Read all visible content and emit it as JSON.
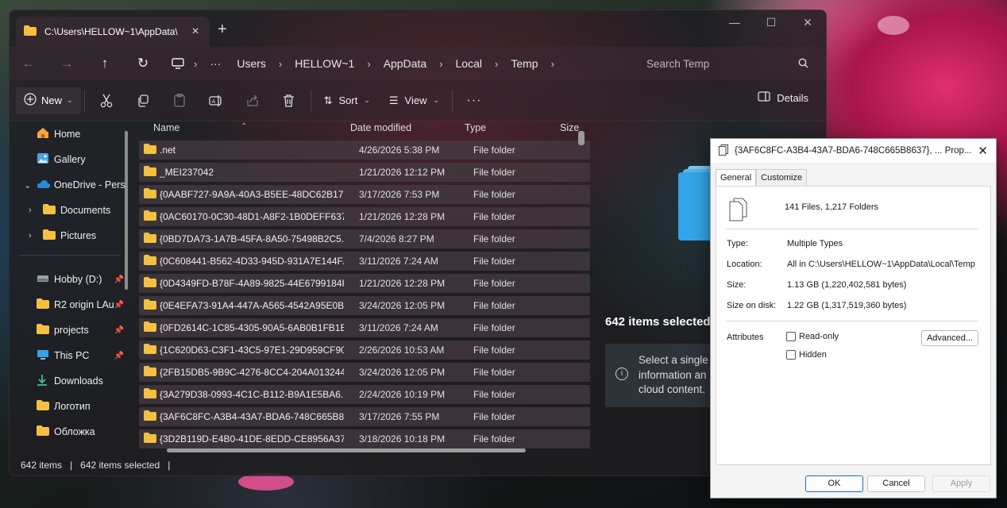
{
  "explorer": {
    "tab_title": "C:\\Users\\HELLOW~1\\AppData\\",
    "address": {
      "crumbs": [
        "Users",
        "HELLOW~1",
        "AppData",
        "Local",
        "Temp"
      ],
      "search_placeholder": "Search Temp"
    },
    "toolbar": {
      "new_label": "New",
      "sort_label": "Sort",
      "view_label": "View",
      "details_label": "Details"
    },
    "sidebar": {
      "items": [
        {
          "label": "Home",
          "icon": "home-icon"
        },
        {
          "label": "Gallery",
          "icon": "gallery-icon"
        },
        {
          "label": "OneDrive - Pers",
          "icon": "cloud-icon"
        },
        {
          "label": "Documents",
          "icon": "folder-icon"
        },
        {
          "label": "Pictures",
          "icon": "folder-icon"
        }
      ],
      "pinned": [
        {
          "label": "Hobby (D:)",
          "icon": "drive-icon"
        },
        {
          "label": "R2 origin LAu",
          "icon": "folder-icon"
        },
        {
          "label": "projects",
          "icon": "folder-icon"
        },
        {
          "label": "This PC",
          "icon": "pc-icon"
        },
        {
          "label": "Downloads",
          "icon": "download-icon"
        },
        {
          "label": "Логотип",
          "icon": "folder-icon"
        },
        {
          "label": "Обложка",
          "icon": "folder-icon"
        }
      ]
    },
    "columns": {
      "name": "Name",
      "date": "Date modified",
      "type": "Type",
      "size": "Size"
    },
    "rows": [
      {
        "name": ".net",
        "date": "4/26/2026 5:38 PM",
        "type": "File folder"
      },
      {
        "name": "_MEI237042",
        "date": "1/21/2026 12:12 PM",
        "type": "File folder"
      },
      {
        "name": "{0AABF727-9A9A-40A3-B5EE-48DC62B17...",
        "date": "3/17/2026 7:53 PM",
        "type": "File folder"
      },
      {
        "name": "{0AC60170-0C30-48D1-A8F2-1B0DEFF637...",
        "date": "1/21/2026 12:28 PM",
        "type": "File folder"
      },
      {
        "name": "{0BD7DA73-1A7B-45FA-8A50-75498B2C5...",
        "date": "7/4/2026 8:27 PM",
        "type": "File folder"
      },
      {
        "name": "{0C608441-B562-4D33-945D-931A7E144F...",
        "date": "3/11/2026 7:24 AM",
        "type": "File folder"
      },
      {
        "name": "{0D4349FD-B78F-4A89-9825-44E6799184F...",
        "date": "1/21/2026 12:28 PM",
        "type": "File folder"
      },
      {
        "name": "{0E4EFA73-91A4-447A-A565-4542A95E0B...",
        "date": "3/24/2026 12:05 PM",
        "type": "File folder"
      },
      {
        "name": "{0FD2614C-1C85-4305-90A5-6AB0B1FB1E...",
        "date": "3/11/2026 7:24 AM",
        "type": "File folder"
      },
      {
        "name": "{1C620D63-C3F1-43C5-97E1-29D959CF90...",
        "date": "2/26/2026 10:53 AM",
        "type": "File folder"
      },
      {
        "name": "{2FB15DB5-9B9C-4276-8CC4-204A013244...",
        "date": "3/24/2026 12:05 PM",
        "type": "File folder"
      },
      {
        "name": "{3A279D38-0993-4C1C-B112-B9A1E5BA6...",
        "date": "2/24/2026 10:19 PM",
        "type": "File folder"
      },
      {
        "name": "{3AF6C8FC-A3B4-43A7-BDA6-748C665B8...",
        "date": "3/17/2026 7:55 PM",
        "type": "File folder"
      },
      {
        "name": "{3D2B119D-E4B0-41DE-8EDD-CE8956A37...",
        "date": "3/18/2026 10:18 PM",
        "type": "File folder"
      }
    ],
    "status": {
      "count": "642 items",
      "selected": "642 items selected"
    },
    "details": {
      "selected_text": "642 items selected",
      "info_text": "Select a single information an cloud content."
    }
  },
  "properties": {
    "title": "{3AF6C8FC-A3B4-43A7-BDA6-748C665B8637}, ... Prop...",
    "tabs": [
      "General",
      "Customize"
    ],
    "summary": "141 Files, 1,217 Folders",
    "type_label": "Type:",
    "type_value": "Multiple Types",
    "location_label": "Location:",
    "location_value": "All in C:\\Users\\HELLOW~1\\AppData\\Local\\Temp",
    "size_label": "Size:",
    "size_value": "1.13 GB (1,220,402,581 bytes)",
    "size_on_disk_label": "Size on disk:",
    "size_on_disk_value": "1.22 GB (1,317,519,360 bytes)",
    "attributes_label": "Attributes",
    "readonly_label": "Read-only",
    "hidden_label": "Hidden",
    "advanced_label": "Advanced...",
    "ok_label": "OK",
    "cancel_label": "Cancel",
    "apply_label": "Apply"
  }
}
